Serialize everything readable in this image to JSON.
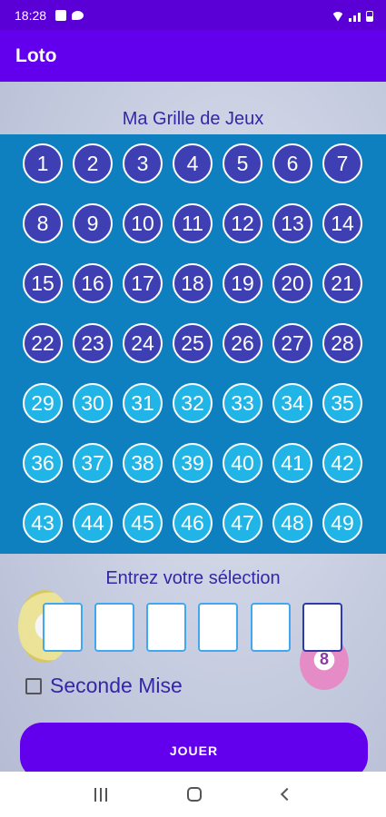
{
  "status_bar": {
    "time": "18:28"
  },
  "app_bar": {
    "title": "Loto"
  },
  "grid": {
    "title": "Ma Grille de Jeux",
    "numbers": [
      "1",
      "2",
      "3",
      "4",
      "5",
      "6",
      "7",
      "8",
      "9",
      "10",
      "11",
      "12",
      "13",
      "14",
      "15",
      "16",
      "17",
      "18",
      "19",
      "20",
      "21",
      "22",
      "23",
      "24",
      "25",
      "26",
      "27",
      "28",
      "29",
      "30",
      "31",
      "32",
      "33",
      "34",
      "35",
      "36",
      "37",
      "38",
      "39",
      "40",
      "41",
      "42",
      "43",
      "44",
      "45",
      "46",
      "47",
      "48",
      "49"
    ]
  },
  "selection": {
    "label": "Entrez votre sélection",
    "values": [
      "",
      "",
      "",
      "",
      "",
      ""
    ]
  },
  "second_bet": {
    "label": "Seconde Mise",
    "checked": false
  },
  "play_button": {
    "label": "JOUER"
  },
  "decoration": {
    "ball_number": "8"
  },
  "colors": {
    "primary": "#6200ee",
    "grid_panel": "#0f80bf",
    "ball_dark": "#3f3fb4",
    "ball_light": "#20b5e6",
    "label_text": "#3327a8"
  }
}
